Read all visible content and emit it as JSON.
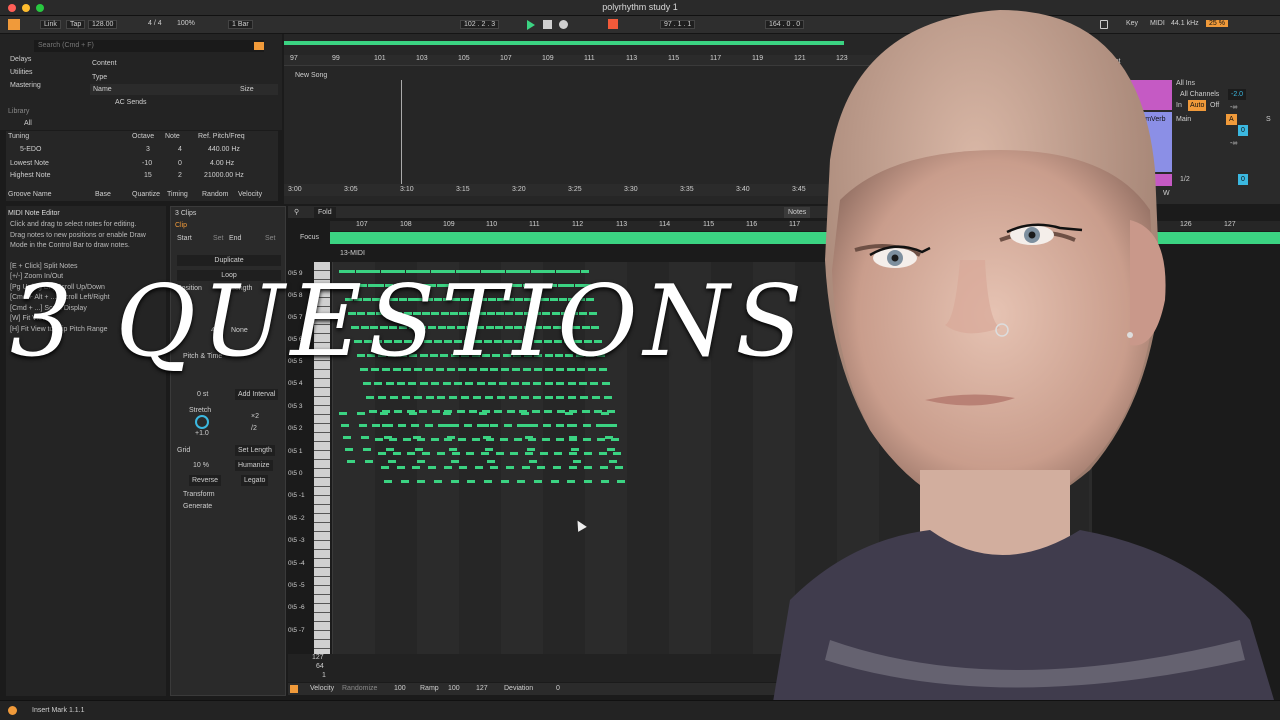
{
  "window": {
    "title": "polyrhythm study 1"
  },
  "control": {
    "link": "Link",
    "tap": "Tap",
    "tempo": "128.00",
    "sig": "4 / 4",
    "zoom": "100%",
    "quant": "1 Bar",
    "pos": "102 . 2 . 3",
    "loop_start": "97 . 1 . 1",
    "loop_len": "164 . 0 . 0",
    "key": "Key",
    "midi": "MIDI",
    "rate": "44.1 kHz",
    "cpu": "25 %"
  },
  "browser": {
    "search": "Search (Cmd + F)",
    "items": [
      "Delays",
      "Utilities",
      "Mastering"
    ],
    "library": "Library",
    "all": "All",
    "content": "Content",
    "type": "Type",
    "name_col": "Name",
    "size_col": "Size",
    "ac_sends": "AC Sends"
  },
  "tuning": {
    "title": "Tuning",
    "cols": [
      "Octave",
      "Note",
      "Ref. Pitch/Freq"
    ],
    "system": "5-EDO",
    "row1": [
      "3",
      "4",
      "440.00 Hz"
    ],
    "lowest": "Lowest Note",
    "low_vals": [
      "-10",
      "0",
      "4.00 Hz"
    ],
    "highest": "Highest Note",
    "high_vals": [
      "15",
      "2",
      "21000.00 Hz"
    ]
  },
  "groove": {
    "cols": [
      "Groove Name",
      "Base",
      "Quantize",
      "Timing",
      "Random",
      "Velocity"
    ]
  },
  "arrange": {
    "set": "New Song",
    "bars": [
      "97",
      "99",
      "101",
      "103",
      "105",
      "107",
      "109",
      "111",
      "113",
      "115",
      "117",
      "119",
      "121",
      "123"
    ],
    "times": [
      "3:00",
      "3:05",
      "3:10",
      "3:15",
      "3:20",
      "3:25",
      "3:30",
      "3:35",
      "3:40",
      "3:45"
    ]
  },
  "help": {
    "title": "MIDI Note Editor",
    "body": [
      "Click and drag to select notes for editing.",
      "Drag notes to new positions or enable Draw",
      "Mode in the Control Bar to draw notes.",
      "",
      "[E + Click] Split Notes",
      "[+/-] Zoom In/Out",
      "[Pg Up/Pg Dn] Scroll Up/Down",
      "[Cmd + Alt + ...] Scroll Left/Right",
      "[Cmd + ...] Scroll Display",
      "[W] Fit View...",
      "[H] Fit View to Clip Pitch Range"
    ]
  },
  "clip": {
    "count": "3 Clips",
    "clip": "Clip",
    "start": "Start",
    "end": "End",
    "set": "Set",
    "duplicate": "Duplicate",
    "loop": "Loop",
    "position": "Position",
    "length": "Length",
    "signature": "Signature",
    "groove": "Groove",
    "sig_val": "4",
    "groove_val": "None",
    "pitch": "Pitch & Time",
    "st": "0 st",
    "add": "Add Interval",
    "stretch": "Stretch",
    "x2": "×2",
    "d2": "/2",
    "stretch_val": "+1.0",
    "grid": "Grid",
    "setlen": "Set Length",
    "pct": "10 %",
    "humanize": "Humanize",
    "reverse": "Reverse",
    "legato": "Legato",
    "transform": "Transform",
    "generate": "Generate"
  },
  "editor": {
    "fold": "Fold",
    "notes": "Notes",
    "focus": "Focus",
    "clipname": "13-MIDI",
    "bars": [
      "107",
      "108",
      "109",
      "110",
      "111",
      "112",
      "113",
      "114",
      "115",
      "116",
      "117"
    ],
    "extra_bars": [
      "126",
      "127"
    ],
    "pitches": [
      "0\\5 9",
      "0\\5 8",
      "0\\5 7",
      "0\\5 6",
      "0\\5 5",
      "0\\5 4",
      "0\\5 3",
      "0\\5 2",
      "0\\5 1",
      "0\\5 0",
      "0\\5 -1",
      "0\\5 -2",
      "0\\5 -3",
      "0\\5 -4",
      "0\\5 -5",
      "0\\5 -6",
      "0\\5 -7"
    ],
    "vel_max": "127",
    "vel_mid": "64",
    "vel_min": "1"
  },
  "velocity": {
    "label": "Velocity",
    "randomize": "Randomize",
    "v100": "100",
    "ramp": "Ramp",
    "r100": "100",
    "r127": "127",
    "deviation": "Deviation",
    "dev": "0"
  },
  "mixer": {
    "set": "Set",
    "allins": "All Ins",
    "allchan": "All Channels",
    "in": "In",
    "auto": "Auto",
    "off": "Off",
    "inf": "-∞",
    "val": "-2.0",
    "track2": "A MCharmVerb",
    "main": "Main",
    "a": "A",
    "s": "S",
    "zero": "0",
    "half": "1/2",
    "h": "H",
    "w": "W"
  },
  "overlay": {
    "text": "3 QUESTIONS"
  },
  "status": {
    "text": "Insert Mark 1.1.1"
  }
}
